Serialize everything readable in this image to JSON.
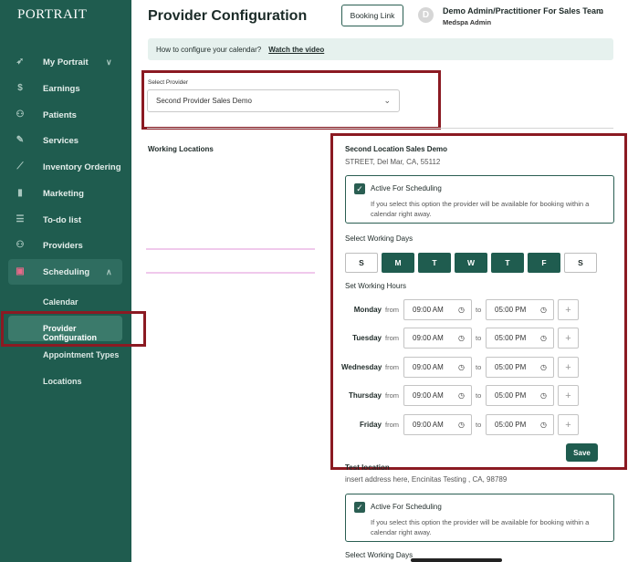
{
  "sidebar": {
    "logo": "PORTRAIT",
    "items": [
      {
        "label": "My Portrait",
        "icon": "rocket-icon",
        "chevron": "∨"
      },
      {
        "label": "Earnings",
        "icon": "dollar-icon"
      },
      {
        "label": "Patients",
        "icon": "users-icon"
      },
      {
        "label": "Services",
        "icon": "services-icon"
      },
      {
        "label": "Inventory Ordering",
        "icon": "trend-icon"
      },
      {
        "label": "Marketing",
        "icon": "bar-chart-icon"
      },
      {
        "label": "To-do list",
        "icon": "list-icon"
      },
      {
        "label": "Providers",
        "icon": "providers-icon"
      },
      {
        "label": "Scheduling",
        "icon": "calendar-icon",
        "chevron": "∧"
      }
    ],
    "sub_items": [
      {
        "label": "Calendar"
      },
      {
        "label": "Provider Configuration"
      },
      {
        "label": "Appointment Types"
      },
      {
        "label": "Locations"
      }
    ]
  },
  "header": {
    "title": "Provider Configuration",
    "booking_link": "Booking Link",
    "avatar_initial": "D",
    "user_name": "Demo Admin/Practitioner For Sales Team",
    "user_role": "Medspa Admin"
  },
  "info": {
    "text": "How to configure your calendar?",
    "link": "Watch the video"
  },
  "provider": {
    "label": "Select Provider",
    "selected": "Second Provider Sales Demo"
  },
  "working_locations": {
    "heading": "Working Locations"
  },
  "location1": {
    "name": "Second Location Sales Demo",
    "address": "STREET, Del Mar, CA, 55112",
    "active_title": "Active For Scheduling",
    "active_desc": "If you select this option the provider will be available for booking within a calendar right away.",
    "days_label": "Select Working Days",
    "days": [
      {
        "letter": "S",
        "on": false
      },
      {
        "letter": "M",
        "on": true
      },
      {
        "letter": "T",
        "on": true
      },
      {
        "letter": "W",
        "on": true
      },
      {
        "letter": "T",
        "on": true
      },
      {
        "letter": "F",
        "on": true
      },
      {
        "letter": "S",
        "on": false
      }
    ],
    "hours_label": "Set Working Hours",
    "from_label": "from",
    "to_label": "to",
    "hours": [
      {
        "day": "Monday",
        "from": "09:00 AM",
        "to": "05:00 PM"
      },
      {
        "day": "Tuesday",
        "from": "09:00 AM",
        "to": "05:00 PM"
      },
      {
        "day": "Wednesday",
        "from": "09:00 AM",
        "to": "05:00 PM"
      },
      {
        "day": "Thursday",
        "from": "09:00 AM",
        "to": "05:00 PM"
      },
      {
        "day": "Friday",
        "from": "09:00 AM",
        "to": "05:00 PM"
      }
    ],
    "save": "Save"
  },
  "location2": {
    "name": "Test location",
    "address": "insert address here, Encinitas Testing , CA, 98789",
    "active_title": "Active For Scheduling",
    "active_desc": "If you select this option the provider will be available for booking within a calendar right away.",
    "days_label": "Select Working Days"
  },
  "icons": {
    "chevron_down": "⌄",
    "check": "✓",
    "clock": "◷",
    "plus": "+"
  },
  "colors": {
    "sidebar": "#1f5c4f",
    "accent": "#1f5c4f",
    "highlight": "#8b1a22"
  }
}
